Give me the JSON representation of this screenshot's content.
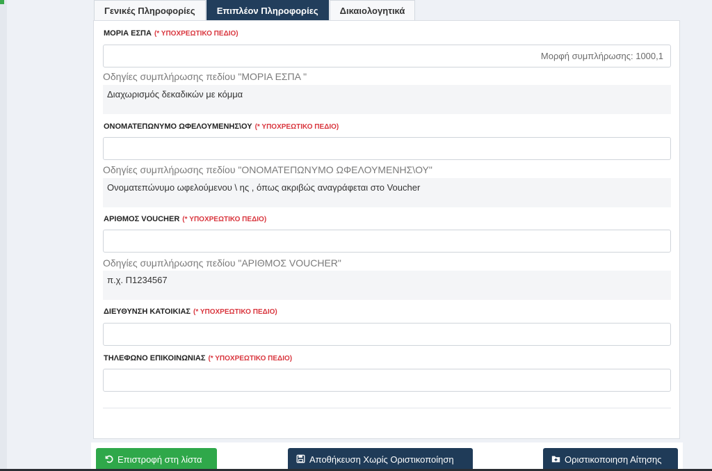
{
  "tabs": [
    {
      "label": "Γενικές Πληροφορίες",
      "active": false
    },
    {
      "label": "Επιπλέον Πληροφορίες",
      "active": true
    },
    {
      "label": "Δικαιολογητικά",
      "active": false
    }
  ],
  "required_text": "(* ΥΠΟΧΡΕΩΤΙΚΟ ΠΕΔΙΟ)",
  "fields": {
    "moria": {
      "label": "ΜΟΡΙΑ ΕΣΠΑ",
      "value": "",
      "placeholder": "Μορφή συμπλήρωσης: 1000,1",
      "hint_title": "Οδηγίες συμπλήρωσης πεδίου \"ΜΟΡΙΑ ΕΣΠΑ \"",
      "hint_text": "Διαχωρισμός δεκαδικών με κόμμα"
    },
    "name": {
      "label": "ΟΝΟΜΑΤΕΠΩΝΥΜΟ ΩΦΕΛΟΥΜΕΝΗΣ\\ΟΥ",
      "value": "",
      "placeholder": "",
      "hint_title": "Οδηγίες συμπλήρωσης πεδίου \"ΟΝΟΜΑΤΕΠΩΝΥΜΟ ΩΦΕΛΟΥΜΕΝΗΣ\\ΟΥ\"",
      "hint_text": "Ονοματεπώνυμο ωφελούμενου \\ ης , όπως ακριβώς αναγράφεται στο Voucher"
    },
    "voucher": {
      "label": "ΑΡΙΘΜΟΣ VOUCHER",
      "value": "",
      "placeholder": "",
      "hint_title": "Οδηγίες συμπλήρωσης πεδίου \"ΑΡΙΘΜΟΣ VOUCHER\"",
      "hint_text": "π.χ. Π1234567"
    },
    "address": {
      "label": "ΔΙΕΥΘΥΝΣΗ ΚΑΤΟΙΚΙΑΣ",
      "value": "",
      "placeholder": ""
    },
    "phone": {
      "label": "ΤΗΛΕΦΩΝΟ ΕΠΙΚΟΙΝΩΝΙΑΣ",
      "value": "",
      "placeholder": ""
    }
  },
  "buttons": {
    "back": "Επιστροφή στη λίστα",
    "save": "Αποθήκευση Χωρίς Οριστικοποίηση",
    "finalize": "Οριστικοποιηση Αίτησης"
  },
  "colors": {
    "active_tab": "#223e5c",
    "required": "#d9363e",
    "green_button": "#2fa84a",
    "navy_button": "#1f3b58"
  },
  "icons": {
    "back": "undo-arrow-icon",
    "save": "floppy-disk-icon",
    "finalize": "folder-plus-icon"
  }
}
